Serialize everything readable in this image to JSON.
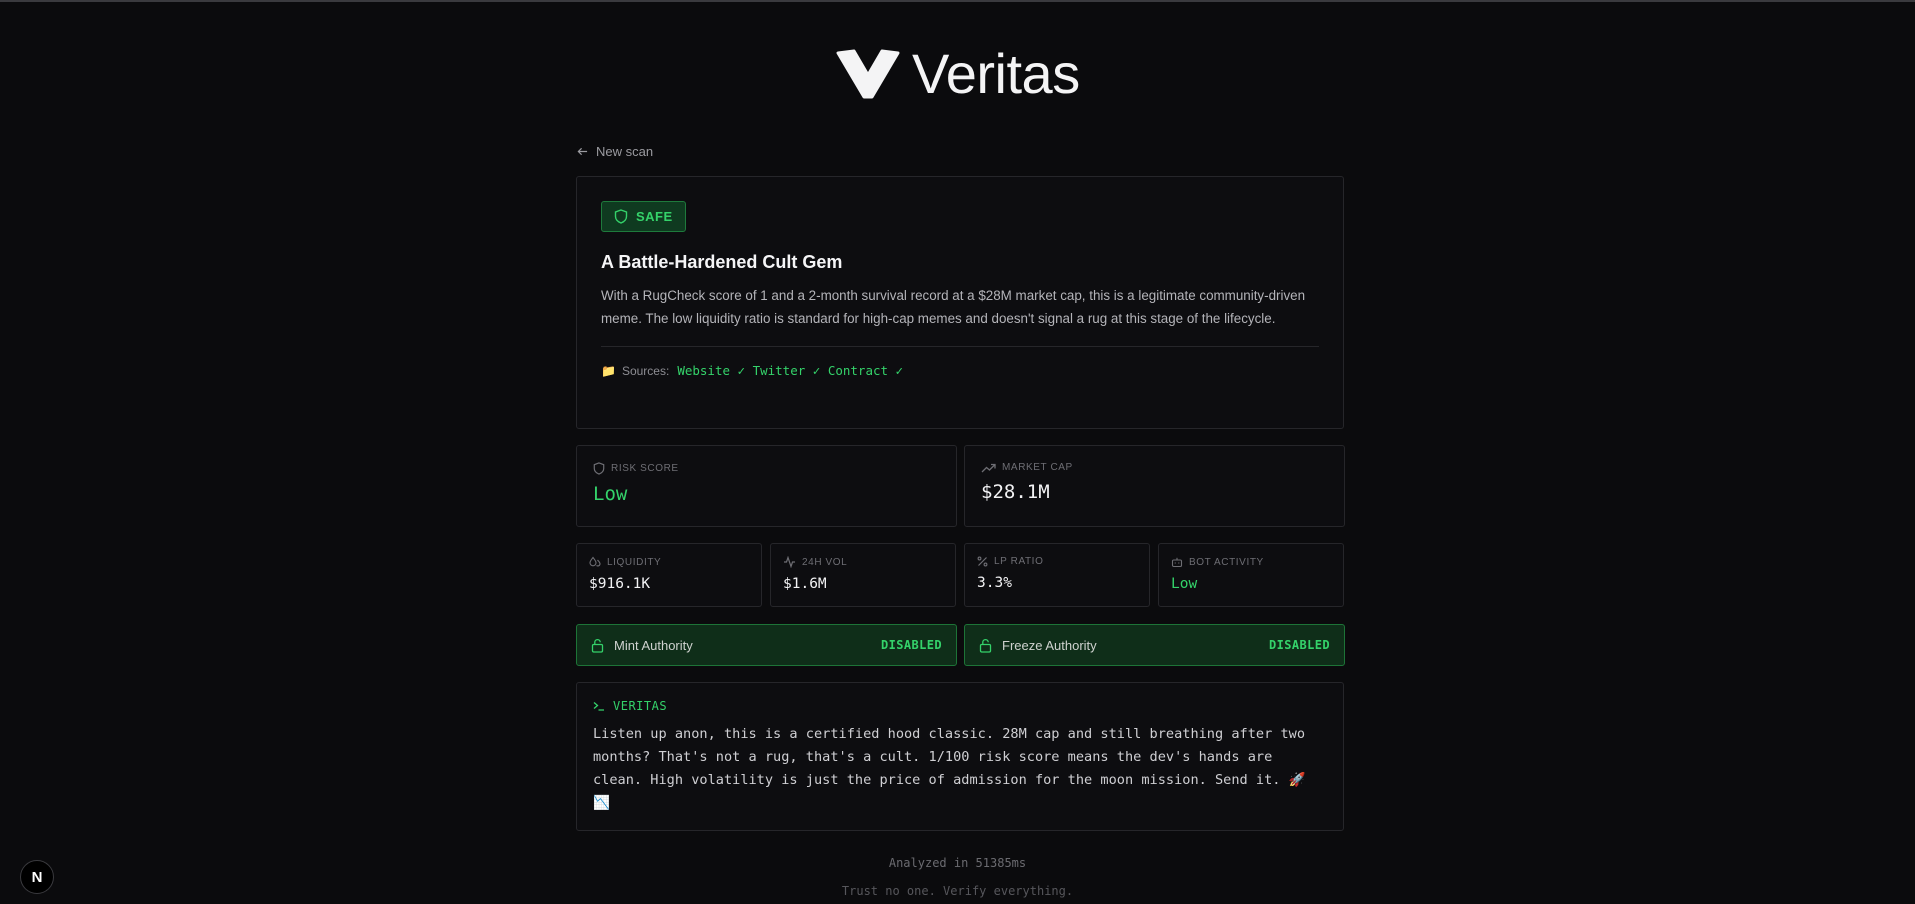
{
  "brand": {
    "name": "Veritas",
    "logo_icon": "veritas-v-logo"
  },
  "nav": {
    "back_label": "New scan",
    "back_icon": "arrow-left-icon"
  },
  "verdict": {
    "badge": "SAFE",
    "badge_icon": "shield-icon",
    "title": "A Battle-Hardened Cult Gem",
    "description": "With a RugCheck score of 1 and a 2-month survival record at a $28M market cap, this is a legitimate community-driven meme. The low liquidity ratio is standard for high-cap memes and doesn't signal a rug at this stage of the lifecycle.",
    "sources_label": "Sources:",
    "sources_icon": "folder-icon",
    "sources_text": "Website ✓ Twitter ✓ Contract ✓"
  },
  "stats_primary": [
    {
      "label": "RISK SCORE",
      "value": "Low",
      "icon": "shield-icon",
      "color": "#34d26a"
    },
    {
      "label": "MARKET CAP",
      "value": "$28.1M",
      "icon": "trending-up-icon",
      "color": "#f2f2f4"
    }
  ],
  "stats_secondary": [
    {
      "label": "LIQUIDITY",
      "value": "$916.1K",
      "icon": "droplets-icon"
    },
    {
      "label": "24H VOL",
      "value": "$1.6M",
      "icon": "activity-icon"
    },
    {
      "label": "LP RATIO",
      "value": "3.3%",
      "icon": "percent-icon"
    },
    {
      "label": "BOT ACTIVITY",
      "value": "Low",
      "icon": "bot-icon"
    }
  ],
  "authorities": [
    {
      "name": "Mint Authority",
      "status": "DISABLED",
      "icon": "lock-icon"
    },
    {
      "name": "Freeze Authority",
      "status": "DISABLED",
      "icon": "lock-icon"
    }
  ],
  "veritas": {
    "heading": "VERITAS",
    "icon": "terminal-icon",
    "text": "Listen up anon, this is a certified hood classic. 28M cap and still breathing after two months? That's not a rug, that's a cult. 1/100 risk score means the dev's hands are clean. High volatility is just the price of admission for the moon mission. Send it. 🚀 📉"
  },
  "footer": {
    "analyzed": "Analyzed in 51385ms",
    "tagline": "Trust no one. Verify everything."
  },
  "dev_button": {
    "label": "N"
  },
  "colors": {
    "accent": "#34d26a",
    "background": "#0b0b0d",
    "card_border": "#26262a"
  }
}
